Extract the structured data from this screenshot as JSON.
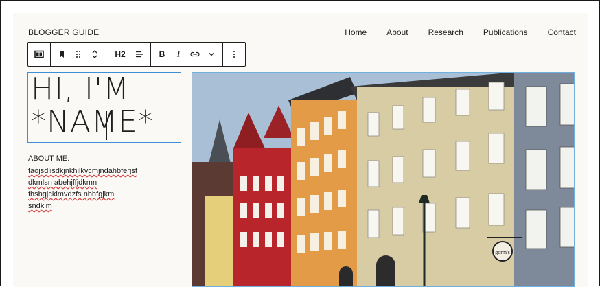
{
  "site": {
    "title": "BLOGGER GUIDE"
  },
  "nav": {
    "items": [
      "Home",
      "About",
      "Research",
      "Publications",
      "Contact"
    ]
  },
  "toolbar": {
    "block_type_icon": "columns-icon",
    "heading_level": "H2",
    "bold_label": "B",
    "italic_label": "I",
    "icons": [
      "bookmark-icon",
      "drag-handle-icon",
      "move-up-down-icon",
      "align-icon",
      "link-icon",
      "chevron-down-icon",
      "more-options-icon"
    ]
  },
  "heading": {
    "text": "HI, I'M\n*NAME*"
  },
  "about": {
    "label": "ABOUT ME:",
    "lines": [
      "faojsdlisdkjnkhilkvcmjndahbferjsf",
      "dkmlsn abehjffjdkmn",
      "fhsbgjcklmvdzfs nbhfgjkm",
      "sndklm"
    ]
  },
  "photo": {
    "shop_sign": "gorm's",
    "colors": {
      "sky": "#a9bfd6",
      "red": "#b8262c",
      "orange": "#e39b48",
      "beige": "#d8cca5",
      "grey": "#7e8a9a",
      "dark": "#3b3b3b"
    }
  },
  "colors": {
    "accent": "#3f8fd6",
    "spell_error": "#d23a3a"
  }
}
